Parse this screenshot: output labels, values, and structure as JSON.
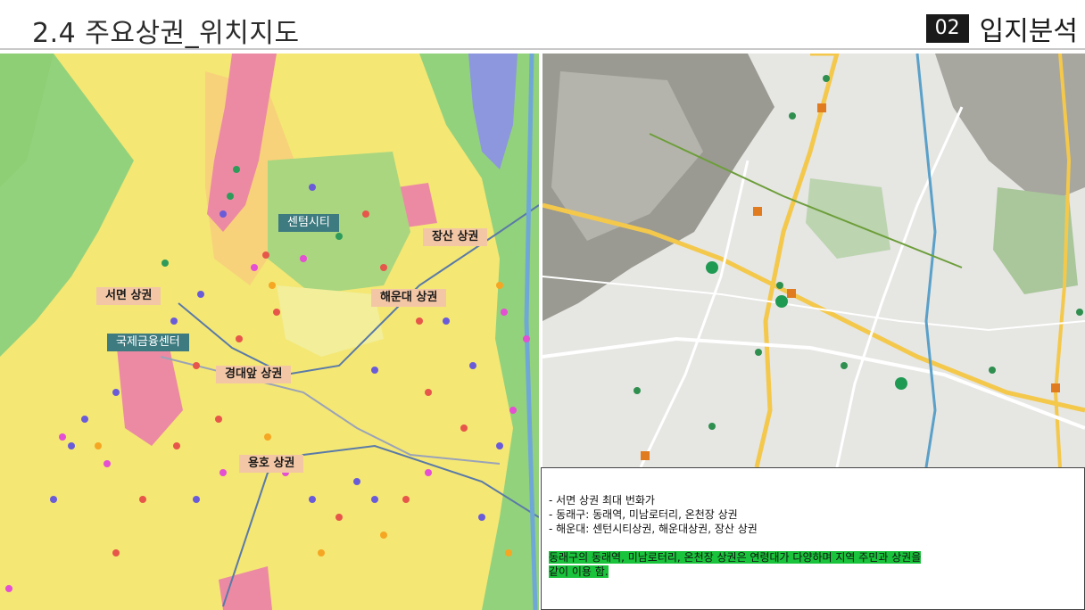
{
  "header": {
    "title": "2.4 주요상권_위치지도",
    "section_number": "02",
    "section_name": "입지분석"
  },
  "left_map": {
    "labels": {
      "centum": "센텀시티",
      "seomyeon": "서면 상권",
      "ifc": "국제금융센터",
      "jangsan": "장산 상권",
      "haeundae": "해운대 상권",
      "gyeongdae": "경대앞 상권",
      "yongho": "용호 상권"
    }
  },
  "notes": {
    "bullets": [
      "서면 상권 최대 번화가",
      "동래구: 동래역, 미남로터리, 온천장 상권",
      "해운대: 센턴시티상권, 해운대상권, 장산 상권"
    ],
    "highlight_line1": "동래구의 동래역, 미남로터리, 온천장 상권은 연령대가 다양하며 지역 주민과  상권을",
    "highlight_line2": "같이 이용 함."
  },
  "colors": {
    "zone_yellow": "#f5e86a",
    "zone_pink": "#ec8aa4",
    "zone_green": "#8ecf75",
    "zone_blue": "#8c97dd",
    "highlight_green": "#19c33b",
    "tag_peach": "#f3c7a6",
    "tag_teal": "#3e7b80"
  }
}
